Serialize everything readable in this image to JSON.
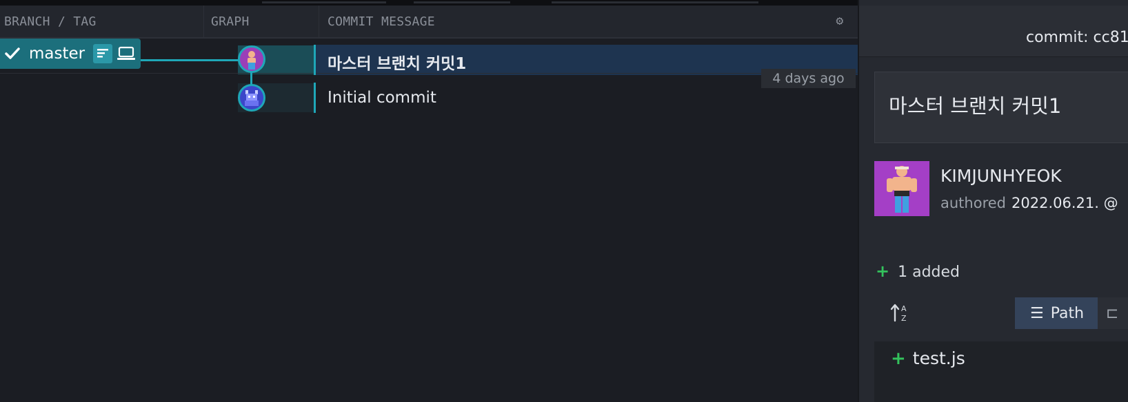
{
  "columns": {
    "branch_tag": "BRANCH / TAG",
    "graph": "GRAPH",
    "commit_message": "COMMIT MESSAGE"
  },
  "branch": {
    "name": "master"
  },
  "commits": [
    {
      "message": "마스터 브랜치 커밋1",
      "date": "4 days ago"
    },
    {
      "message": "Initial commit"
    }
  ],
  "details": {
    "commit_label": "commit: cc81",
    "message": "마스터 브랜치 커밋1",
    "author": "KIMJUNHYEOK",
    "authored_label": "authored",
    "authored_date": "2022.06.21. @",
    "added_summary": "1 added",
    "view_path_label": "Path",
    "files": [
      "test.js"
    ]
  },
  "colors": {
    "accent": "#1fa7b8",
    "branch_pill": "#1c6f7c",
    "selected_row": "#1e3450",
    "added": "#33c25c",
    "author_avatar": "#a43fc6"
  },
  "icons": {
    "settings": "gear-icon",
    "check": "check-icon",
    "branch_tag": "list-tag-icon",
    "local": "laptop-icon",
    "sort": "sort-az-icon",
    "path_view": "list-icon",
    "tree_view": "tree-icon"
  }
}
